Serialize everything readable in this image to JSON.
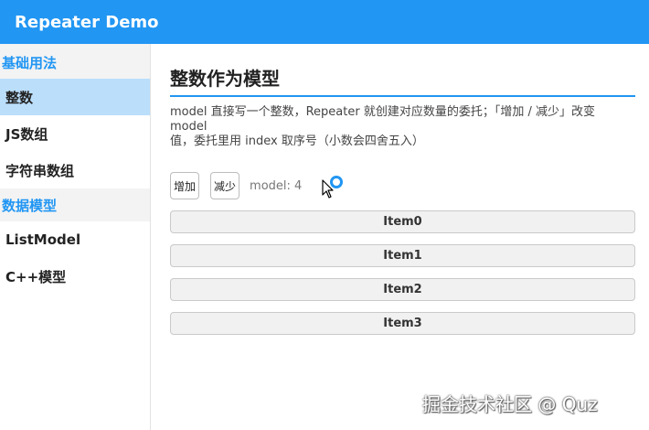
{
  "app": {
    "title": "Repeater Demo"
  },
  "sidebar": {
    "groups": [
      {
        "header": "基础用法",
        "items": [
          {
            "label": "整数",
            "active": true
          },
          {
            "label": "JS数组",
            "active": false
          },
          {
            "label": "字符串数组",
            "active": false
          }
        ]
      },
      {
        "header": "数据模型",
        "items": [
          {
            "label": "ListModel",
            "active": false
          },
          {
            "label": "C++模型",
            "active": false
          }
        ]
      }
    ]
  },
  "main": {
    "title": "整数作为模型",
    "description_line1": "model 直接写一个整数，Repeater 就创建对应数量的委托；「增加 / 减少」改变 model",
    "description_line2": "值，委托里用 index 取序号（小数会四舍五入）",
    "increase_label": "增加",
    "decrease_label": "减少",
    "model_text": "model: 4",
    "items": [
      "Item0",
      "Item1",
      "Item2",
      "Item3"
    ]
  },
  "watermark": "掘金技术社区 @ Quz",
  "colors": {
    "accent": "#2196f3",
    "active_item_bg": "#bbdefb",
    "group_header_bg": "#f3f3f3"
  },
  "icons": {
    "cursor": "arrow-cursor-icon",
    "busy": "busy-ring-icon"
  }
}
